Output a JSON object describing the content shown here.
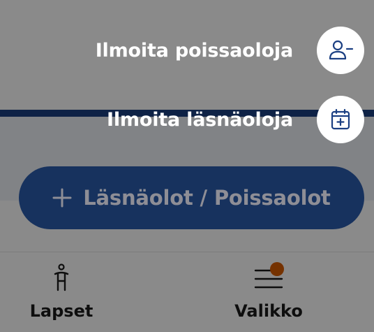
{
  "fab_menu": {
    "absence_label": "Ilmoita poissaoloja",
    "absence_icon": "person-remove-icon",
    "presence_label": "Ilmoita läsnäoloja",
    "presence_icon": "calendar-add-icon",
    "main_label": "Läsnäolot / Poissaolot",
    "main_icon": "plus-icon"
  },
  "bottom_nav": {
    "items": [
      {
        "label": "Lapset",
        "icon": "child-icon"
      },
      {
        "label": "Valikko",
        "icon": "menu-icon",
        "has_notification_badge": true
      }
    ]
  },
  "colors": {
    "primary": "#1b3f82",
    "fab_background": "#17325e",
    "badge": "#d85d00",
    "scrim": "rgba(0,0,0,0.46)"
  }
}
